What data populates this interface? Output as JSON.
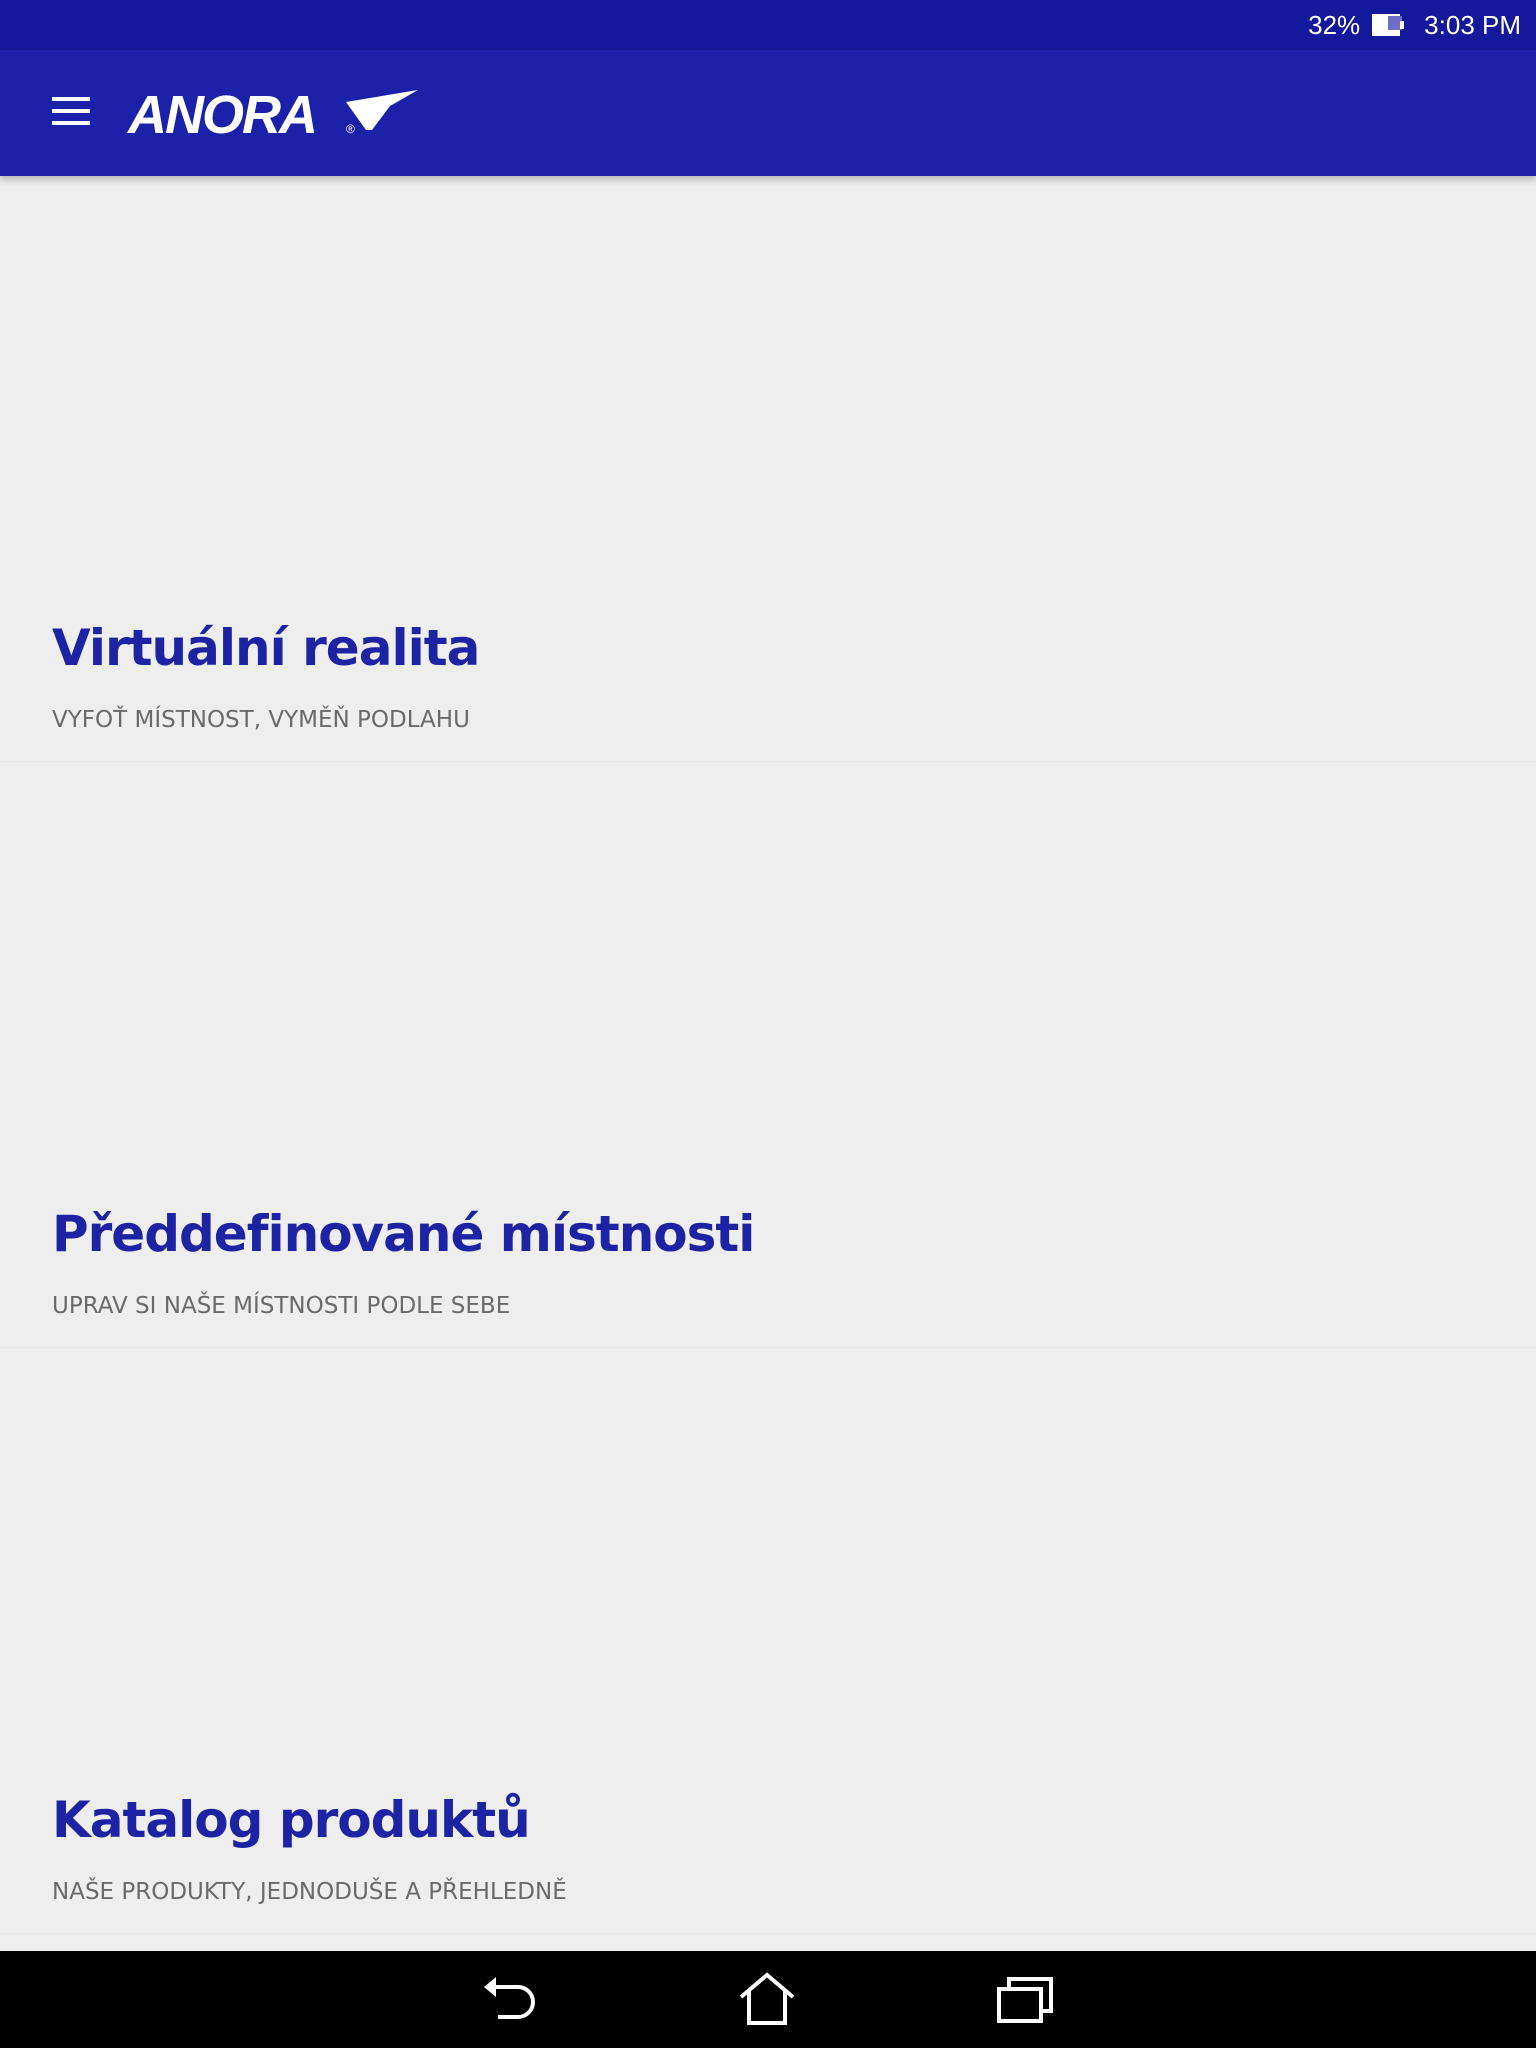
{
  "status_bar": {
    "battery_percent": "32%",
    "battery_icon": "battery-icon",
    "time": "3:03 PM"
  },
  "app_bar": {
    "menu_icon": "hamburger-menu-icon",
    "logo_text": "ANORA",
    "logo_mark": "®"
  },
  "cards": [
    {
      "title": "Virtuální realita",
      "subtitle": "VYFOŤ MÍSTNOST, VYMĚŇ PODLAHU"
    },
    {
      "title": "Předdefinované místnosti",
      "subtitle": "UPRAV SI NAŠE MÍSTNOSTI PODLE SEBE"
    },
    {
      "title": "Katalog produktů",
      "subtitle": "NAŠE PRODUKTY, JEDNODUŠE A PŘEHLEDNĚ"
    }
  ],
  "nav_bar": {
    "back_icon": "back-icon",
    "home_icon": "home-icon",
    "recents_icon": "recent-apps-icon"
  },
  "colors": {
    "status_bar": "#13199a",
    "app_bar": "#1c21aa",
    "title": "#1e23a3",
    "subtitle": "#6a6a6a",
    "background": "#eeeeee"
  }
}
